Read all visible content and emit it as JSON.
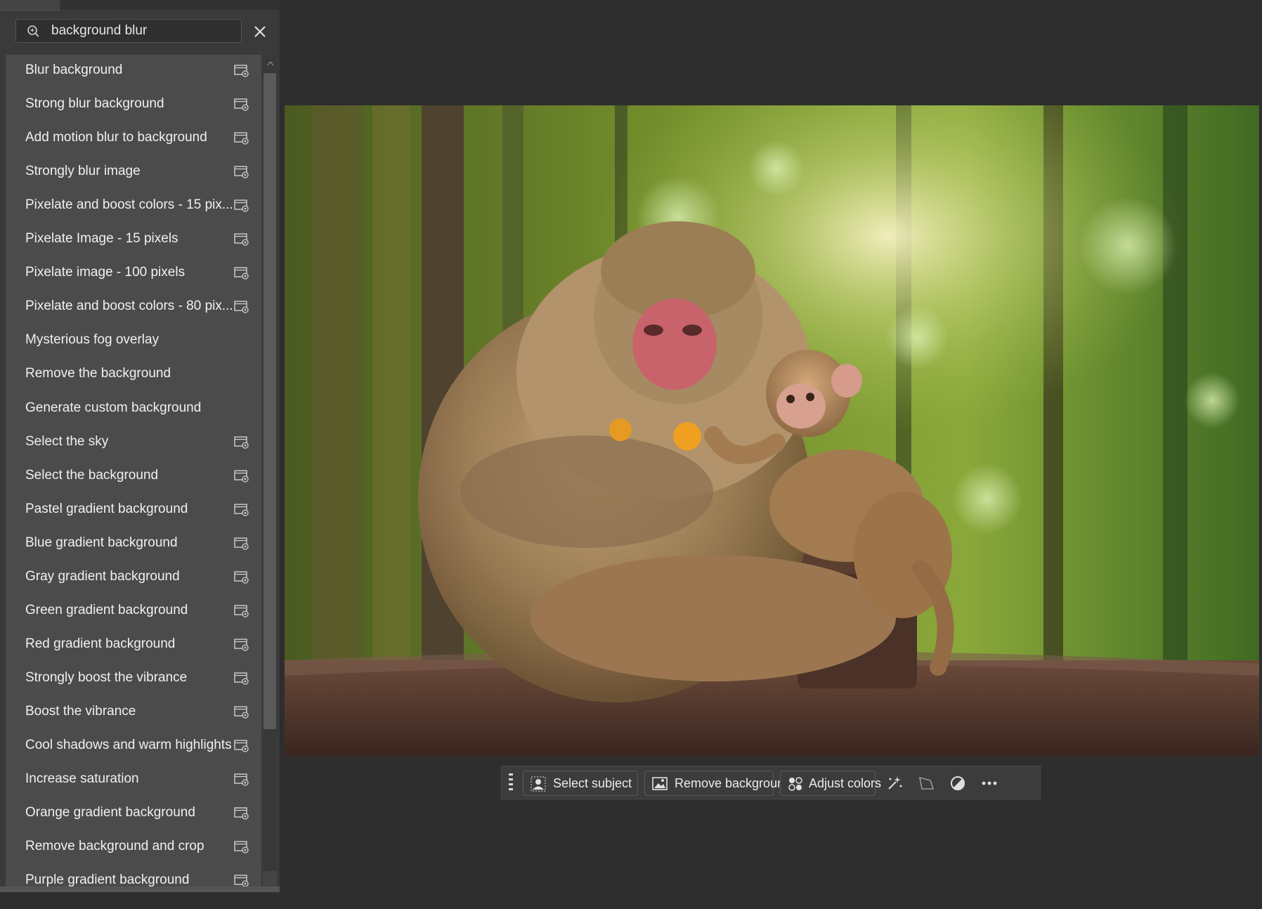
{
  "search": {
    "value": "background blur",
    "placeholder": ""
  },
  "results": [
    {
      "label": "Blur background",
      "has_icon": true
    },
    {
      "label": "Strong blur background",
      "has_icon": true
    },
    {
      "label": "Add motion blur to background",
      "has_icon": true
    },
    {
      "label": "Strongly blur image",
      "has_icon": true
    },
    {
      "label": "Pixelate and boost colors - 15 pix...",
      "has_icon": true
    },
    {
      "label": "Pixelate Image - 15 pixels",
      "has_icon": true
    },
    {
      "label": "Pixelate image - 100 pixels",
      "has_icon": true
    },
    {
      "label": "Pixelate and boost colors - 80 pix...",
      "has_icon": true
    },
    {
      "label": "Mysterious fog overlay",
      "has_icon": false
    },
    {
      "label": "Remove the background",
      "has_icon": false
    },
    {
      "label": "Generate custom background",
      "has_icon": false
    },
    {
      "label": "Select the sky",
      "has_icon": true
    },
    {
      "label": "Select the background",
      "has_icon": true
    },
    {
      "label": "Pastel gradient background",
      "has_icon": true
    },
    {
      "label": "Blue gradient background",
      "has_icon": true
    },
    {
      "label": "Gray gradient background",
      "has_icon": true
    },
    {
      "label": "Green gradient background",
      "has_icon": true
    },
    {
      "label": "Red gradient background",
      "has_icon": true
    },
    {
      "label": "Strongly boost the vibrance",
      "has_icon": true
    },
    {
      "label": "Boost the vibrance",
      "has_icon": true
    },
    {
      "label": "Cool shadows and warm highlights",
      "has_icon": true
    },
    {
      "label": "Increase saturation",
      "has_icon": true
    },
    {
      "label": "Orange gradient background",
      "has_icon": true
    },
    {
      "label": "Remove background and crop",
      "has_icon": true
    },
    {
      "label": "Purple gradient background",
      "has_icon": true
    }
  ],
  "taskbar": {
    "select_subject": "Select subject",
    "remove_background": "Remove background",
    "adjust_colors": "Adjust colors",
    "icons": [
      "generative-fill-icon",
      "transform-icon",
      "adjustment-icon",
      "more-icon"
    ]
  },
  "colors": {
    "app_background": "#2e2e2e",
    "panel_background": "#4b4b4b",
    "text": "#f0f0f0"
  }
}
